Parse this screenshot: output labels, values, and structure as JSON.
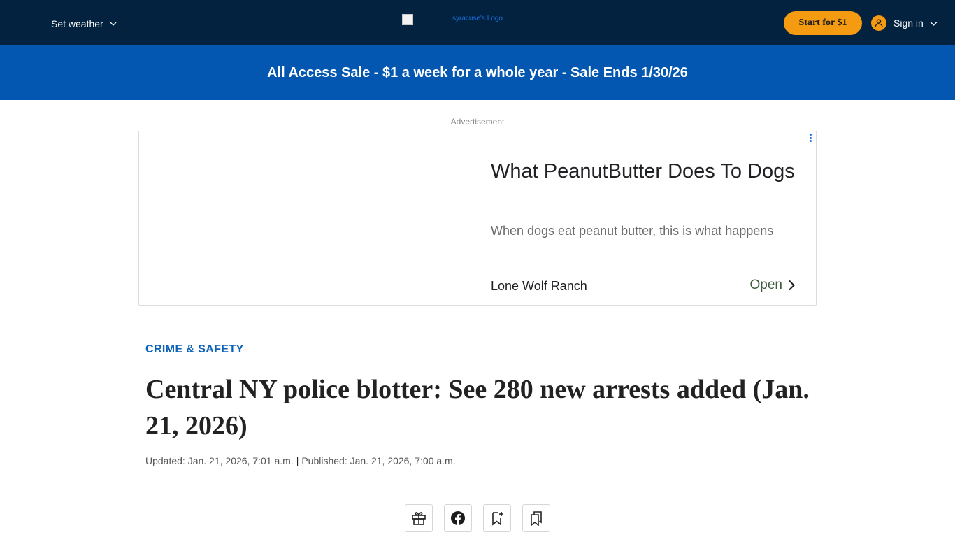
{
  "topnav": {
    "weather_label": "Set weather",
    "logo_alt": "syracuse's Logo",
    "start_label": "Start for $1",
    "signin_label": "Sign in"
  },
  "promo": {
    "text": "All Access Sale - $1 a week for a whole year - Sale Ends 1/30/26"
  },
  "ad": {
    "label": "Advertisement",
    "headline": "What PeanutButter Does To Dogs",
    "description": "When dogs eat peanut butter, this is what happens",
    "advertiser": "Lone Wolf Ranch",
    "cta": "Open"
  },
  "article": {
    "kicker": "CRIME & SAFETY",
    "headline": "Central NY police blotter: See 280 new arrests added (Jan. 21, 2026)",
    "updated": "Updated: Jan. 21, 2026, 7:01 a.m.",
    "separator": "|",
    "published": "Published: Jan. 21, 2026, 7:00 a.m."
  },
  "share": {
    "icons": [
      "gift-icon",
      "facebook-icon",
      "bookmark-add-icon",
      "saved-bookmarks-icon"
    ]
  },
  "colors": {
    "nav_bg": "#02223f",
    "promo_bg": "#0357b0",
    "accent_orange": "#f49b12",
    "kicker_blue": "#0b62b8"
  }
}
